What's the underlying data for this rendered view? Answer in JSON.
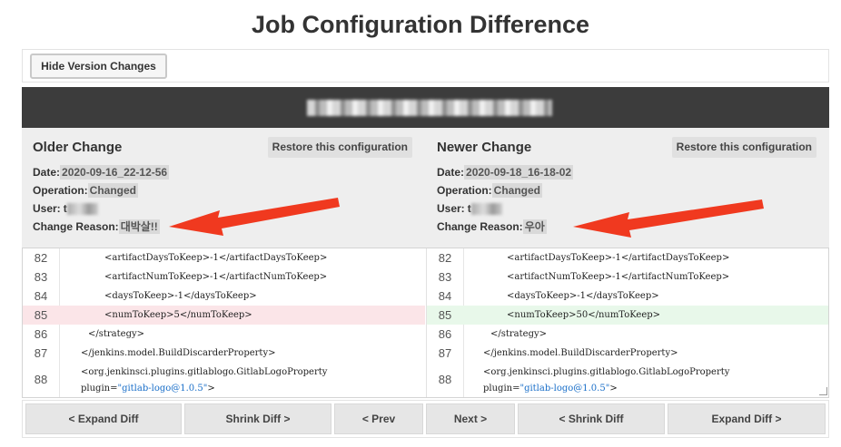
{
  "page": {
    "title": "Job Configuration Difference"
  },
  "toolbar": {
    "hide_label": "Hide Version Changes"
  },
  "older": {
    "heading": "Older Change",
    "restore_label": "Restore this configuration",
    "date_label": "Date:",
    "date": "2020-09-16_22-12-56",
    "operation_label": "Operation:",
    "operation": "Changed",
    "user_label": "User:",
    "user_initial": "t",
    "reason_label": "Change Reason:",
    "reason": "대박살!!"
  },
  "newer": {
    "heading": "Newer Change",
    "restore_label": "Restore this configuration",
    "date_label": "Date:",
    "date": "2020-09-18_16-18-02",
    "operation_label": "Operation:",
    "operation": "Changed",
    "user_label": "User:",
    "user_initial": "t",
    "reason_label": "Change Reason:",
    "reason": "우아"
  },
  "diff": {
    "left": [
      {
        "num": "82",
        "code": "<artifactDaysToKeep>-1</artifactDaysToKeep>"
      },
      {
        "num": "83",
        "code": "<artifactNumToKeep>-1</artifactNumToKeep>"
      },
      {
        "num": "84",
        "code": "<daysToKeep>-1</daysToKeep>"
      },
      {
        "num": "85",
        "code": "<numToKeep>5</numToKeep>"
      },
      {
        "num": "86",
        "code": "</strategy>"
      },
      {
        "num": "87",
        "code": "</jenkins.model.BuildDiscarderProperty>"
      },
      {
        "num": "88",
        "code": "<org.jenkinsci.plugins.gitlablogo.GitlabLogoProperty",
        "cont_attr": "plugin=",
        "cont_val": "\"gitlab-logo@1.0.5\"",
        "cont_end": ">"
      }
    ],
    "right": [
      {
        "num": "82",
        "code": "<artifactDaysToKeep>-1</artifactDaysToKeep>"
      },
      {
        "num": "83",
        "code": "<artifactNumToKeep>-1</artifactNumToKeep>"
      },
      {
        "num": "84",
        "code": "<daysToKeep>-1</daysToKeep>"
      },
      {
        "num": "85",
        "code": "<numToKeep>50</numToKeep>"
      },
      {
        "num": "86",
        "code": "</strategy>"
      },
      {
        "num": "87",
        "code": "</jenkins.model.BuildDiscarderProperty>"
      },
      {
        "num": "88",
        "code": "<org.jenkinsci.plugins.gitlablogo.GitlabLogoProperty",
        "cont_attr": "plugin=",
        "cont_val": "\"gitlab-logo@1.0.5\"",
        "cont_end": ">"
      }
    ],
    "colors": {
      "deleted": "#fbe5e8",
      "added": "#e8f8ea",
      "string": "#1a6fc9"
    }
  },
  "nav": {
    "expand_left": "< Expand Diff",
    "shrink_left": "Shrink Diff >",
    "prev": "< Prev",
    "next": "Next >",
    "shrink_right": "< Shrink Diff",
    "expand_right": "Expand Diff >"
  },
  "annotations": {
    "arrow_color": "#f0391f"
  }
}
